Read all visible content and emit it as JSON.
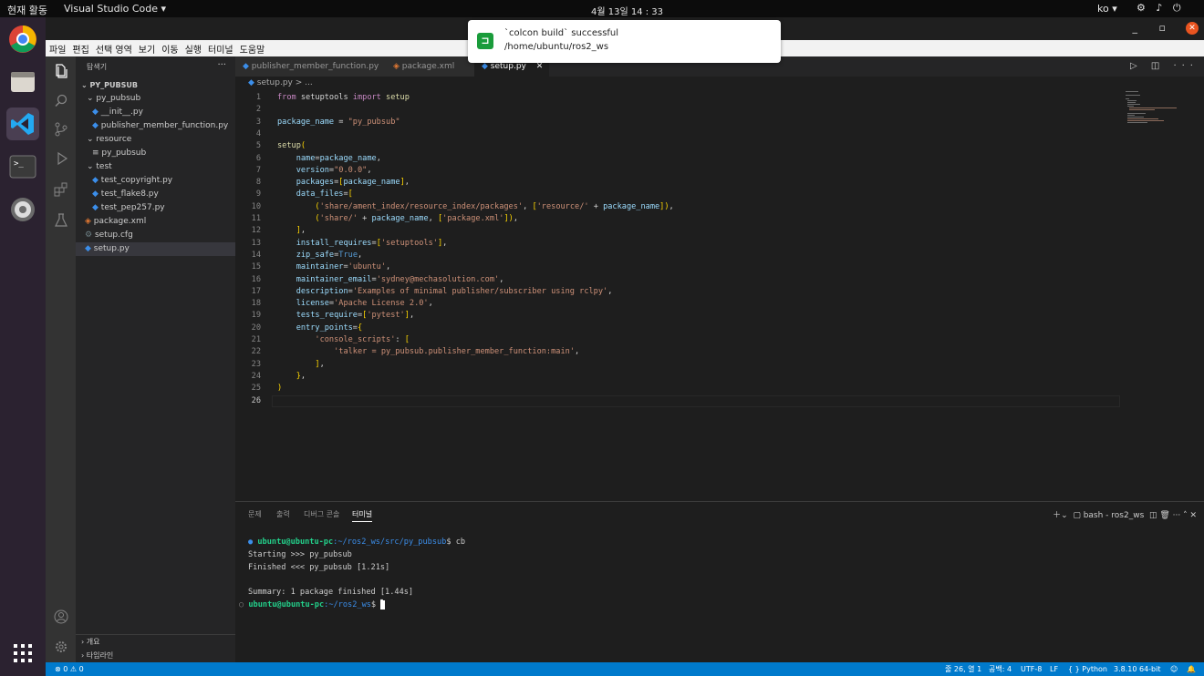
{
  "system": {
    "activities_label": "현재 활동",
    "app_name": "Visual Studio Code ▾",
    "clock": "4월 13일  14 : 33",
    "lang": "ko ▾"
  },
  "notification": {
    "title": "`colcon build` successful",
    "body": "/home/ubuntu/ros2_ws"
  },
  "menu": [
    "파일",
    "편집",
    "선택 영역",
    "보기",
    "이동",
    "실행",
    "터미널",
    "도움말"
  ],
  "sidebar": {
    "header": "탐색기",
    "root": "PY_PUBSUB",
    "items": [
      "py_pubsub",
      "__init__.py",
      "publisher_member_function.py",
      "resource",
      "py_pubsub",
      "test",
      "test_copyright.py",
      "test_flake8.py",
      "test_pep257.py",
      "package.xml",
      "setup.cfg",
      "setup.py"
    ],
    "outline": "개요",
    "timeline": "타임라인"
  },
  "tabs": [
    "publisher_member_function.py",
    "package.xml",
    "setup.py"
  ],
  "breadcrumb": "setup.py  >  ...",
  "code_lines": [
    "from setuptools import setup",
    "",
    "package_name = \"py_pubsub\"",
    "",
    "setup(",
    "    name=package_name,",
    "    version=\"0.0.0\",",
    "    packages=[package_name],",
    "    data_files=[",
    "        ('share/ament_index/resource_index/packages', ['resource/' + package_name]),",
    "        ('share/' + package_name, ['package.xml']),",
    "    ],",
    "    install_requires=['setuptools'],",
    "    zip_safe=True,",
    "    maintainer='ubuntu',",
    "    maintainer_email='sydney@mechasolution.com',",
    "    description='Examples of minimal publisher/subscriber using rclpy',",
    "    license='Apache License 2.0',",
    "    tests_require=['pytest'],",
    "    entry_points={",
    "        'console_scripts': [",
    "            'talker = py_pubsub.publisher_member_function:main',",
    "        ],",
    "    },",
    ")",
    ""
  ],
  "panel": {
    "tabs": [
      "문제",
      "출력",
      "디버그 콘솔",
      "터미널"
    ],
    "shell": "bash - ros2_ws",
    "prompt1_user": "ubuntu@ubuntu-pc",
    "prompt1_path": ":~/ros2_ws/src/py_pubsub",
    "prompt1_cmd": "$ cb",
    "out1": "Starting >>> py_pubsub",
    "out2": "Finished <<< py_pubsub [1.21s]",
    "out3": "Summary: 1 package finished [1.44s]",
    "prompt2_user": "ubuntu@ubuntu-pc",
    "prompt2_path": ":~/ros2_ws",
    "prompt2_cmd": "$ "
  },
  "status": {
    "problems": "⊗ 0 ⚠ 0",
    "position": "줄 26, 열 1",
    "spaces": "공백: 4",
    "encoding": "UTF-8",
    "eol": "LF",
    "language": "{ } Python",
    "interpreter": "3.8.10 64-bit"
  }
}
